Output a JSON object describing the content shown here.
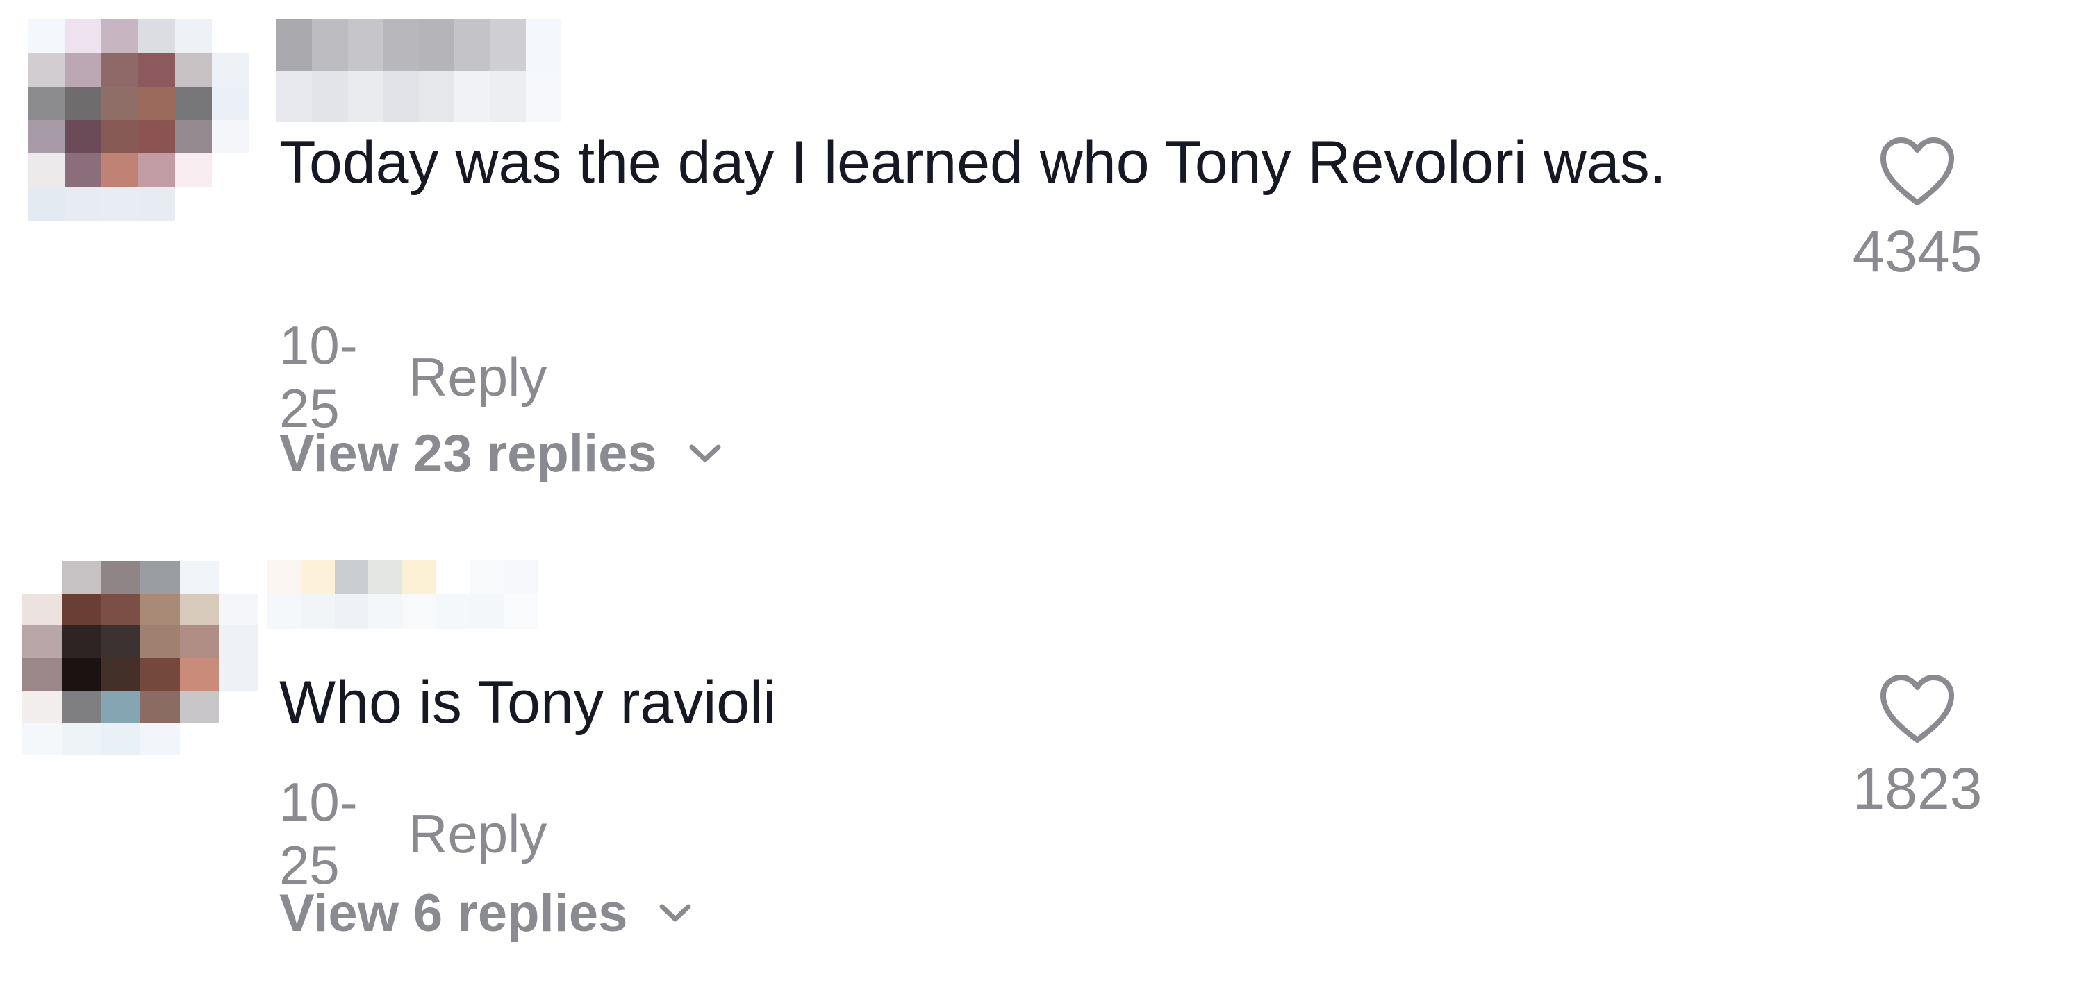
{
  "comments": [
    {
      "text": "Today was the day I learned who Tony Revolori was.",
      "date": "10-25",
      "reply_label": "Reply",
      "view_replies_label": "View 23 replies",
      "like_count": "4345",
      "avatar_pixels": [
        "#f4f7fb",
        "#efe2ef",
        "#c7b6c2",
        "#dcdde3",
        "#eef2f6",
        "#ffffff",
        "#d2cdd0",
        "#bca7b4",
        "#8f6868",
        "#8c5a5e",
        "#c7c1c3",
        "#eef1f5",
        "#8c8b8d",
        "#6e6c6d",
        "#8e6e67",
        "#9c6a5c",
        "#77777a",
        "#eaf0f6",
        "#a89ba8",
        "#6a4b57",
        "#885a56",
        "#8b5452",
        "#938a90",
        "#f4f6fa",
        "#eceaeb",
        "#8b6e7b",
        "#c08274",
        "#c19ca5",
        "#f7edf1",
        "#ffffff",
        "#e3eaf1",
        "#e6ecf2",
        "#e7edf3",
        "#e6ecf2",
        "#ffffff",
        "#ffffff"
      ],
      "username_pixels": [
        "#a9a9ae",
        "#bdbdc1",
        "#c6c6ca",
        "#b7b7bc",
        "#b4b4b9",
        "#c4c4c8",
        "#cfcfd3",
        "#f4f7fb",
        "#e7e9ee",
        "#e2e4e9",
        "#e9ebef",
        "#e1e3e8",
        "#e5e7eb",
        "#f0f2f6",
        "#eceef2",
        "#f6f8fb"
      ]
    },
    {
      "text": "Who is Tony ravioli",
      "date": "10-25",
      "reply_label": "Reply",
      "view_replies_label": "View 6 replies",
      "like_count": "1823",
      "avatar_pixels": [
        "#ffffff",
        "#c6c2c4",
        "#8f8586",
        "#9a9ea3",
        "#f1f4f8",
        "#ffffff",
        "#ece3e0",
        "#6a3d35",
        "#7c4f46",
        "#a98a76",
        "#d8cabb",
        "#f4f6fa",
        "#b9a6a8",
        "#2f2424",
        "#3c3232",
        "#a08070",
        "#b08e85",
        "#eef2f6",
        "#9b878a",
        "#1b1212",
        "#433029",
        "#74483a",
        "#c98b7a",
        "#eef2f6",
        "#f2eeee",
        "#7f7e80",
        "#85a5b2",
        "#8a6c62",
        "#c8c6c8",
        "#ffffff",
        "#f4f8fb",
        "#eef3f7",
        "#e9f0f6",
        "#f2f6fa",
        "#ffffff",
        "#ffffff"
      ],
      "username_pixels": [
        "#fbf6ef",
        "#fdf1da",
        "#c9ccd0",
        "#e4e6e3",
        "#fbf0d4",
        "#ffffff",
        "#f7f9fb",
        "#f6f8fb",
        "#f5f8fb",
        "#f2f5f8",
        "#eef2f6",
        "#f4f7fa",
        "#f7f9fb",
        "#f5f8fb",
        "#f4f7fa",
        "#f9fbfc"
      ]
    }
  ],
  "colors": {
    "text_primary": "#161823",
    "text_secondary": "#8a8b91"
  },
  "icons": {
    "like": "heart-outline-icon",
    "expand": "chevron-down-icon"
  }
}
